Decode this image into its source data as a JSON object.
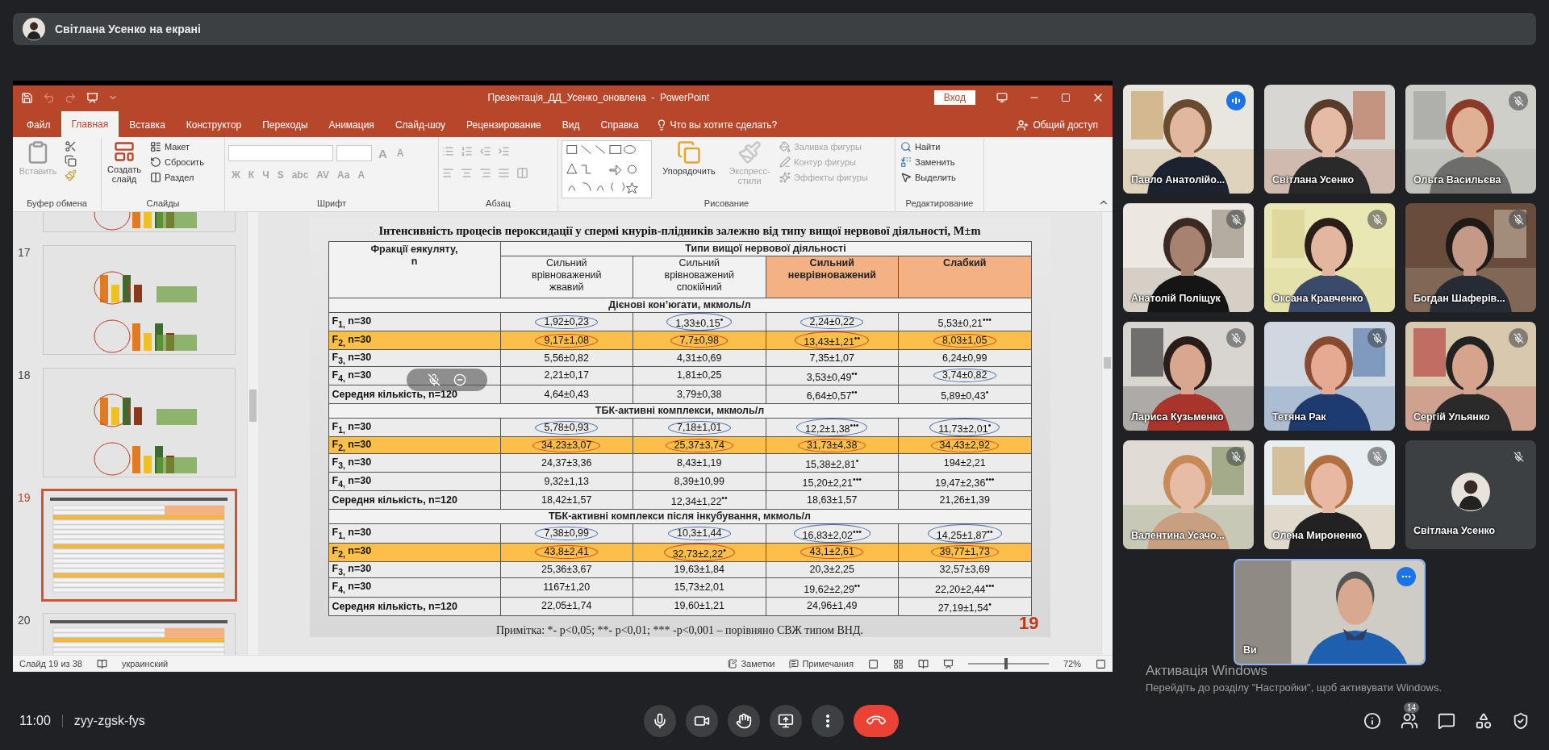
{
  "banner": {
    "text": "Світлана Усенко на екрані"
  },
  "powerpoint": {
    "title": "Презентація_ДД_Усенко_оновлена  -  PowerPoint",
    "login_button": "Вход",
    "quick_access": [
      {
        "kind": "save",
        "disabled": false
      },
      {
        "kind": "undo",
        "disabled": true
      },
      {
        "kind": "redo",
        "disabled": true
      },
      {
        "kind": "present",
        "disabled": false
      },
      {
        "kind": "customize",
        "disabled": false
      }
    ],
    "tabs": [
      {
        "label": "Файл",
        "selected": false
      },
      {
        "label": "Главная",
        "selected": true
      },
      {
        "label": "Вставка",
        "selected": false
      },
      {
        "label": "Конструктор",
        "selected": false
      },
      {
        "label": "Переходы",
        "selected": false
      },
      {
        "label": "Анимация",
        "selected": false
      },
      {
        "label": "Слайд-шоу",
        "selected": false
      },
      {
        "label": "Рецензирование",
        "selected": false
      },
      {
        "label": "Вид",
        "selected": false
      },
      {
        "label": "Справка",
        "selected": false
      }
    ],
    "tell_me": "Что вы хотите сделать?",
    "share": "Общий доступ",
    "groups": [
      {
        "kind": "clipboard",
        "label": "Буфер обмена",
        "items": [
          {
            "label": "Вставить",
            "disabled": true
          }
        ]
      },
      {
        "kind": "slides",
        "label": "Слайды",
        "items": [
          {
            "label": "Создать слайд",
            "disabled": false
          },
          {
            "label": "Макет",
            "disabled": false
          },
          {
            "label": "Сбросить",
            "disabled": false
          },
          {
            "label": "Раздел",
            "disabled": false
          }
        ]
      },
      {
        "kind": "font",
        "label": "Шрифт",
        "size_buttons": [
          {
            "label": "A",
            "disabled": true
          },
          {
            "label": "A",
            "disabled": true
          }
        ],
        "items": [
          {
            "label": "Ж",
            "disabled": true
          },
          {
            "label": "К",
            "disabled": true
          },
          {
            "label": "Ч",
            "disabled": true
          },
          {
            "label": "S",
            "disabled": true
          },
          {
            "label": "abc",
            "disabled": true
          },
          {
            "label": "AV",
            "disabled": true
          },
          {
            "label": "Aa",
            "disabled": true
          },
          {
            "label": "A",
            "disabled": true
          }
        ]
      },
      {
        "kind": "paragraph",
        "label": "Абзац"
      },
      {
        "kind": "drawing",
        "label": "Рисование",
        "items": [
          {
            "label": "Упорядочить",
            "disabled": false
          },
          {
            "label": "Экспресс-стили",
            "disabled": true
          },
          {
            "label": "Заливка фигуры",
            "disabled": true
          },
          {
            "label": "Контур фигуры",
            "disabled": true
          },
          {
            "label": "Эффекты фигуры",
            "disabled": true
          }
        ]
      },
      {
        "kind": "editing",
        "label": "Редактирование",
        "items": [
          {
            "label": "Найти",
            "disabled": false
          },
          {
            "label": "Заменить",
            "disabled": false
          },
          {
            "label": "Выделить",
            "disabled": false
          }
        ]
      }
    ],
    "thumbnails": [
      {
        "kind": "chart",
        "selected": false
      },
      {
        "number": "17",
        "kind": "chart",
        "selected": false
      },
      {
        "number": "18",
        "kind": "chart",
        "selected": false
      },
      {
        "number": "19",
        "kind": "table",
        "selected": true
      },
      {
        "number": "20",
        "kind": "table",
        "selected": false
      }
    ],
    "slide": {
      "title": "Інтенсивність процесів пероксидації у спермі кнурів-плідників залежно від типу вищої нервової діяльності, M±m",
      "row_header": "Фракції еякуляту, n",
      "group_header": "Типи вищої нервової діяльності",
      "columns": [
        {
          "label": "Сильний врівноважений жвавий",
          "highlighted": false
        },
        {
          "label": "Сильний врівноважений спокійний",
          "highlighted": false
        },
        {
          "label": "Сильний неврівноважений",
          "highlighted": true
        },
        {
          "label": "Слабкий",
          "highlighted": true
        }
      ],
      "sections": [
        {
          "title": "Дієнові кон’югати, мкмоль/л",
          "rows": [
            {
              "label": "F$_{1,}$ n=30",
              "highlighted": false,
              "cells": [
                {
                  "value": "1,92±0,23",
                  "color": "#4a6fb5"
                },
                {
                  "value": "1,33±0,15$^{•}$",
                  "color": "#4a6fb5"
                },
                {
                  "value": "2,24±0,22",
                  "color": "#4a6fb5"
                },
                {
                  "value": "5,53±0,21$^{•••}$"
                }
              ]
            },
            {
              "label": "F$_{2,}$ n=30",
              "highlighted": true,
              "cells": [
                {
                  "value": "9,17±1,08",
                  "color": "#e0401a"
                },
                {
                  "value": "7,7±0,98",
                  "color": "#e0401a"
                },
                {
                  "value": "13,43±1,21$^{••}$",
                  "color": "#e0401a"
                },
                {
                  "value": "8,03±1,05",
                  "color": "#e0401a"
                }
              ]
            },
            {
              "label": "F$_{3,}$ n=30",
              "highlighted": false,
              "cells": [
                {
                  "value": "5,56±0,82"
                },
                {
                  "value": "4,31±0,69"
                },
                {
                  "value": "7,35±1,07"
                },
                {
                  "value": "6,24±0,99"
                }
              ]
            },
            {
              "label": "F$_{4,}$ n=30",
              "highlighted": false,
              "cells": [
                {
                  "value": "2,21±0,17"
                },
                {
                  "value": "1,81±0,25"
                },
                {
                  "value": "3,53±0,49$^{••}$"
                },
                {
                  "value": "3,74±0,82",
                  "color": "#4a6fb5"
                }
              ]
            },
            {
              "label": "Середня кількість, n=120",
              "highlighted": false,
              "cells": [
                {
                  "value": "4,64±0,43"
                },
                {
                  "value": "3,79±0,38"
                },
                {
                  "value": "6,64±0,57$^{••}$"
                },
                {
                  "value": "5,89±0,43$^{•}$"
                }
              ]
            }
          ]
        },
        {
          "title": "ТБК-активні комплекси, мкмоль/л",
          "rows": [
            {
              "label": "F$_{1,}$ n=30",
              "highlighted": false,
              "cells": [
                {
                  "value": "5,78±0,93",
                  "color": "#4a6fb5"
                },
                {
                  "value": "7,18±1,01",
                  "color": "#4a6fb5"
                },
                {
                  "value": "12,2±1,38$^{•••}$",
                  "color": "#4a6fb5"
                },
                {
                  "value": "11,73±2,01$^{•}$",
                  "color": "#4a6fb5"
                }
              ]
            },
            {
              "label": "F$_{2,}$ n=30",
              "highlighted": true,
              "cells": [
                {
                  "value": "34,23±3,07",
                  "color": "#e0401a"
                },
                {
                  "value": "25,37±3,74",
                  "color": "#e0401a"
                },
                {
                  "value": "31,73±4,38",
                  "color": "#e0401a"
                },
                {
                  "value": "34,43±2,92",
                  "color": "#e0401a"
                }
              ]
            },
            {
              "label": "F$_{3,}$ n=30",
              "highlighted": false,
              "cells": [
                {
                  "value": "24,37±3,36"
                },
                {
                  "value": "8,43±1,19"
                },
                {
                  "value": "15,38±2,81$^{•}$"
                },
                {
                  "value": "194±2,21"
                }
              ]
            },
            {
              "label": "F$_{4,}$ n=30",
              "highlighted": false,
              "cells": [
                {
                  "value": "9,32±1,13"
                },
                {
                  "value": "8,39±10,99"
                },
                {
                  "value": "15,20±2,21$^{•••}$"
                },
                {
                  "value": "19,47±2,36$^{•••}$"
                }
              ]
            },
            {
              "label": "Середня кількість, n=120",
              "highlighted": false,
              "cells": [
                {
                  "value": "18,42±1,57"
                },
                {
                  "value": "12,34±1,22$^{••}$"
                },
                {
                  "value": "18,63±1,57"
                },
                {
                  "value": "21,26±1,39"
                }
              ]
            }
          ]
        },
        {
          "title": "ТБК-активні комплекси після інкубування, мкмоль/л",
          "rows": [
            {
              "label": "F$_{1,}$ n=30",
              "highlighted": false,
              "cells": [
                {
                  "value": "7,38±0,99",
                  "color": "#4a6fb5"
                },
                {
                  "value": "10,3±1,44",
                  "color": "#4a6fb5"
                },
                {
                  "value": "16,83±2,02$^{•••}$",
                  "color": "#4a6fb5"
                },
                {
                  "value": "14,25±1,87$^{••}$",
                  "color": "#4a6fb5"
                }
              ]
            },
            {
              "label": "F$_{2,}$ n=30",
              "highlighted": true,
              "cells": [
                {
                  "value": "43,8±2,41",
                  "color": "#e0401a"
                },
                {
                  "value": "32,73±2,22$^{•}$",
                  "color": "#e0401a"
                },
                {
                  "value": "43,1±2,61",
                  "color": "#e0401a"
                },
                {
                  "value": "39,77±1,73",
                  "color": "#e0401a"
                }
              ]
            },
            {
              "label": "F$_{3,}$ n=30",
              "highlighted": false,
              "cells": [
                {
                  "value": "25,36±3,67"
                },
                {
                  "value": "19,63±1,84"
                },
                {
                  "value": "20,3±2,25"
                },
                {
                  "value": "32,57±3,69"
                }
              ]
            },
            {
              "label": "F$_{4,}$ n=30",
              "highlighted": false,
              "cells": [
                {
                  "value": "1167±1,20"
                },
                {
                  "value": "15,73±2,01"
                },
                {
                  "value": "19,62±2,29$^{••}$"
                },
                {
                  "value": "22,20±2,44$^{•••}$"
                }
              ]
            },
            {
              "label": "Середня кількість, n=120",
              "highlighted": false,
              "cells": [
                {
                  "value": "22,05±1,74"
                },
                {
                  "value": "19,60±1,21"
                },
                {
                  "value": "24,96±1,49"
                },
                {
                  "value": "27,19±1,54$^{•}$"
                }
              ]
            }
          ]
        }
      ],
      "note": "Примітка: *- р<0,05; **- р<0,01; *** -р<0,001 – порівняно СВЖ типом ВНД.",
      "number": "19"
    },
    "status_bar": {
      "slide": "Слайд 19 из 38",
      "language": "украинский",
      "notes": "Заметки",
      "comments": "Примечания",
      "zoom": {
        "level": 0.45,
        "reading": "72%"
      }
    }
  },
  "participants": [
    {
      "name": "Павло Анатолійо...",
      "kind": "video",
      "muted": false,
      "speaking": true
    },
    {
      "name": "Світлана Усенко",
      "kind": "video",
      "muted": false,
      "speaking": false
    },
    {
      "name": "Ольга Васильєва",
      "kind": "video",
      "muted": true,
      "speaking": false
    },
    {
      "name": "Анатолій Поліщук",
      "kind": "video",
      "muted": true,
      "speaking": false
    },
    {
      "name": "Оксана Кравченко",
      "kind": "video",
      "muted": true,
      "speaking": false
    },
    {
      "name": "Богдан Шаферів...",
      "kind": "video",
      "muted": true,
      "speaking": false
    },
    {
      "name": "Лариса Кузьменко",
      "kind": "video",
      "muted": true,
      "speaking": false
    },
    {
      "name": "Тетяна Рак",
      "kind": "video",
      "muted": true,
      "speaking": false
    },
    {
      "name": "Сергій Ульянко",
      "kind": "video",
      "muted": true,
      "speaking": false
    },
    {
      "name": "Валентина Усачо...",
      "kind": "video",
      "muted": true,
      "speaking": false
    },
    {
      "name": "Олена Мироненко",
      "kind": "video",
      "muted": true,
      "speaking": false
    },
    {
      "name": "Світлана Усенко",
      "kind": "avatar",
      "muted": true,
      "speaking": false
    }
  ],
  "self": {
    "name": "Ви",
    "kind": "video"
  },
  "bottom_bar": {
    "time": "11:00",
    "meeting_code": "zyy-zgsk-fys",
    "people_count": "14"
  },
  "windows_notice": {
    "title": "Активація Windows",
    "text": "Перейдіть до розділу \"Настройки\", щоб активувати Windows."
  }
}
